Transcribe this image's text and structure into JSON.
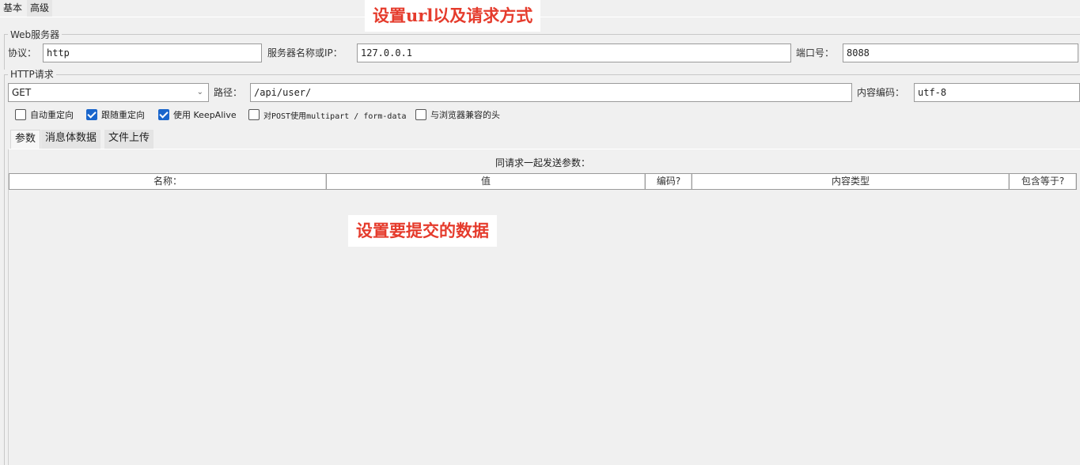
{
  "top_tabs": [
    {
      "label": "基本",
      "active": true
    },
    {
      "label": "高级",
      "active": false
    }
  ],
  "web_server": {
    "legend": "Web服务器",
    "protocol_label": "协议：",
    "protocol_value": "http",
    "server_label": "服务器名称或IP：",
    "server_value": "127.0.0.1",
    "port_label": "端口号：",
    "port_value": "8088"
  },
  "http_request": {
    "legend": "HTTP请求",
    "method_value": "GET",
    "path_label": "路径：",
    "path_value": "/api/user/",
    "encoding_label": "内容编码：",
    "encoding_value": "utf-8"
  },
  "options": [
    {
      "label": "自动重定向",
      "checked": false
    },
    {
      "label": "跟随重定向",
      "checked": true
    },
    {
      "label": "使用 KeepAlive",
      "checked": true
    },
    {
      "label": "对POST使用multipart / form-data",
      "checked": false
    },
    {
      "label": "与浏览器兼容的头",
      "checked": false
    }
  ],
  "inner_tabs": [
    {
      "label": "参数",
      "active": true
    },
    {
      "label": "消息体数据",
      "active": false
    },
    {
      "label": "文件上传",
      "active": false
    }
  ],
  "params_table": {
    "caption": "同请求一起发送参数：",
    "columns": [
      "名称：",
      "值",
      "编码?",
      "内容类型",
      "包含等于?"
    ]
  },
  "annotations": {
    "url_note": "设置url以及请求方式",
    "data_note": "设置要提交的数据"
  },
  "colors": {
    "annotation_text": "#e53b2c",
    "checkbox_checked": "#1a66cc"
  },
  "icons": {
    "method_dropdown": "chevron-down-icon"
  }
}
